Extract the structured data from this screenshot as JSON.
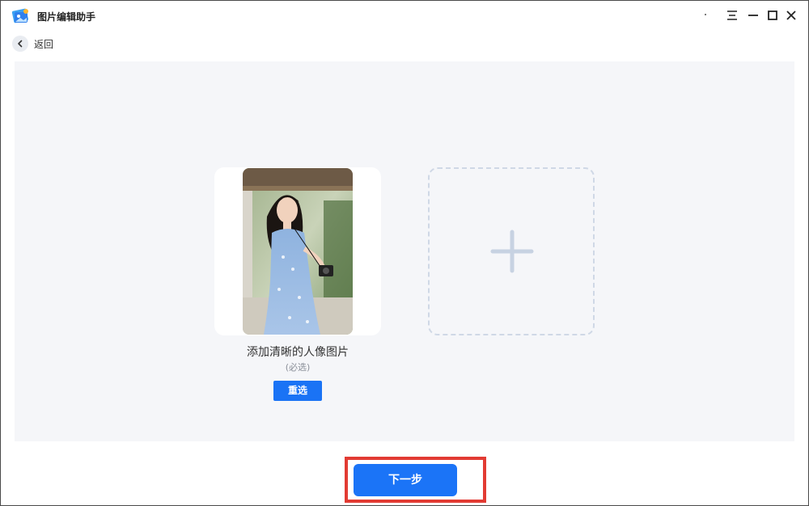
{
  "app": {
    "title": "图片编辑助手",
    "logo_icon": "app-logo-icon"
  },
  "window_controls": {
    "menu_icon": "menu-icon",
    "minimize_icon": "minimize-icon",
    "maximize_icon": "maximize-icon",
    "close_icon": "close-icon"
  },
  "nav": {
    "back_label": "返回",
    "back_icon": "chevron-left-icon"
  },
  "upload": {
    "portrait_caption": "添加清晰的人像图片",
    "portrait_required": "(必选)",
    "reselect_label": "重选",
    "add_icon": "plus-icon"
  },
  "footer": {
    "next_label": "下一步"
  },
  "colors": {
    "accent": "#1b74f7",
    "panel_bg": "#f5f6f9",
    "highlight": "#e23b33",
    "dashed_border": "#cfd8e6"
  }
}
